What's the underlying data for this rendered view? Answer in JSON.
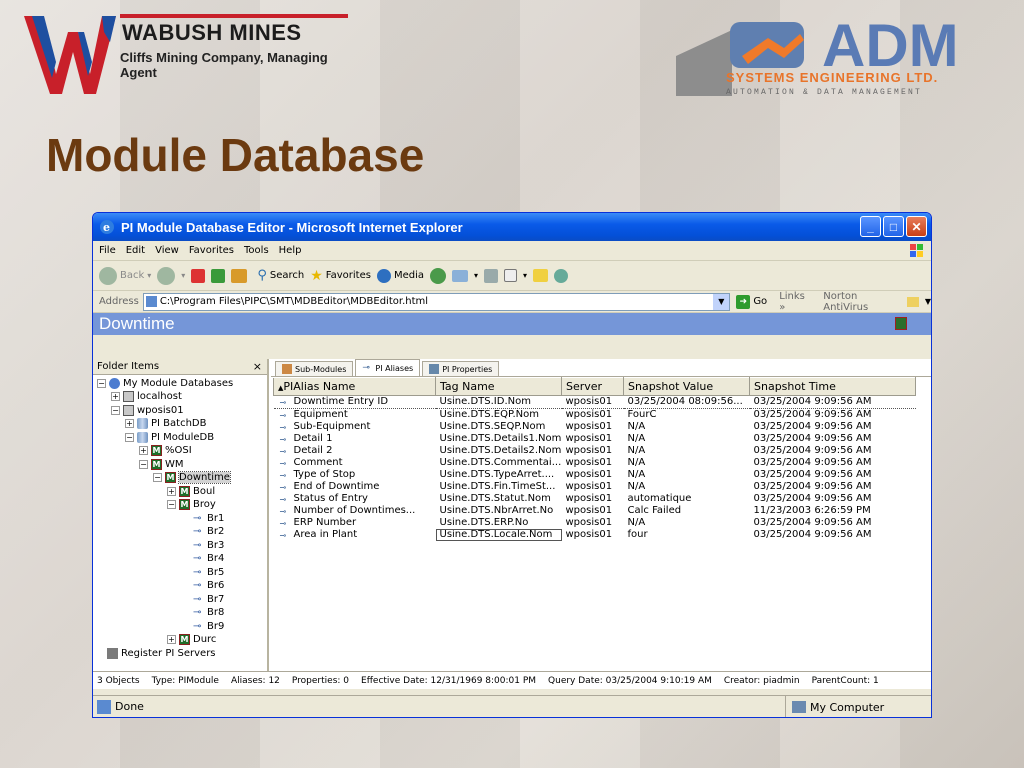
{
  "slide": {
    "title": "Module Database",
    "logo_left": {
      "name": "WABUSH MINES",
      "subtitle": "Cliffs Mining Company, Managing Agent"
    },
    "logo_right": {
      "name": "ADM",
      "line1": "SYSTEMS ENGINEERING LTD.",
      "line2": "AUTOMATION & DATA MANAGEMENT"
    }
  },
  "window": {
    "title": "PI Module Database Editor - Microsoft Internet Explorer",
    "menu": [
      "File",
      "Edit",
      "View",
      "Favorites",
      "Tools",
      "Help"
    ],
    "toolbar": {
      "back": "Back",
      "search": "Search",
      "favorites": "Favorites",
      "media": "Media"
    },
    "address": {
      "label": "Address",
      "value": "C:\\Program Files\\PIPC\\SMT\\MDBEditor\\MDBEditor.html",
      "go": "Go",
      "links": "Links",
      "links_more": "»",
      "norton": "Norton AntiVirus"
    },
    "page_header": "Downtime",
    "folder_pane": {
      "title": "Folder Items",
      "close": "×",
      "nodes": [
        {
          "label": "My Module Databases",
          "exp": "−"
        },
        {
          "label": "localhost",
          "exp": "+"
        },
        {
          "label": "wposis01",
          "exp": "−"
        },
        {
          "label": "PI BatchDB",
          "exp": "+"
        },
        {
          "label": "PI ModuleDB",
          "exp": "−"
        },
        {
          "label": "%OSI",
          "exp": "+"
        },
        {
          "label": "WM",
          "exp": "−"
        },
        {
          "label": "Downtime",
          "exp": "−"
        },
        {
          "label": "Boul",
          "exp": "+"
        },
        {
          "label": "Broy",
          "exp": "−"
        },
        {
          "label": "Br1"
        },
        {
          "label": "Br2"
        },
        {
          "label": "Br3"
        },
        {
          "label": "Br4"
        },
        {
          "label": "Br5"
        },
        {
          "label": "Br6"
        },
        {
          "label": "Br7"
        },
        {
          "label": "Br8"
        },
        {
          "label": "Br9"
        },
        {
          "label": "Durc",
          "exp": "+"
        },
        {
          "label": "Register PI Servers"
        }
      ]
    },
    "tabs": [
      "Sub-Modules",
      "PI Aliases",
      "PI Properties"
    ],
    "table": {
      "sort_indicator": "▲",
      "columns": [
        "PIAlias Name",
        "Tag Name",
        "Server",
        "Snapshot Value",
        "Snapshot Time"
      ],
      "rows": [
        [
          "Downtime Entry ID",
          "Usine.DTS.ID.Nom",
          "wposis01",
          "03/25/2004 08:09:56...",
          "03/25/2004 9:09:56 AM"
        ],
        [
          "Equipment",
          "Usine.DTS.EQP.Nom",
          "wposis01",
          "FourC",
          "03/25/2004 9:09:56 AM"
        ],
        [
          "Sub-Equipment",
          "Usine.DTS.SEQP.Nom",
          "wposis01",
          "N/A",
          "03/25/2004 9:09:56 AM"
        ],
        [
          "Detail 1",
          "Usine.DTS.Details1.Nom",
          "wposis01",
          "N/A",
          "03/25/2004 9:09:56 AM"
        ],
        [
          "Detail 2",
          "Usine.DTS.Details2.Nom",
          "wposis01",
          "N/A",
          "03/25/2004 9:09:56 AM"
        ],
        [
          "Comment",
          "Usine.DTS.Commentai...",
          "wposis01",
          "N/A",
          "03/25/2004 9:09:56 AM"
        ],
        [
          "Type of Stop",
          "Usine.DTS.TypeArret....",
          "wposis01",
          "N/A",
          "03/25/2004 9:09:56 AM"
        ],
        [
          "End of Downtime",
          "Usine.DTS.Fin.TimeSt...",
          "wposis01",
          "N/A",
          "03/25/2004 9:09:56 AM"
        ],
        [
          "Status of Entry",
          "Usine.DTS.Statut.Nom",
          "wposis01",
          "automatique",
          "03/25/2004 9:09:56 AM"
        ],
        [
          "Number of Downtimes...",
          "Usine.DTS.NbrArret.No",
          "wposis01",
          "Calc Failed",
          "11/23/2003 6:26:59 PM"
        ],
        [
          "ERP Number",
          "Usine.DTS.ERP.No",
          "wposis01",
          "N/A",
          "03/25/2004 9:09:56 AM"
        ],
        [
          "Area in Plant",
          "Usine.DTS.Locale.Nom",
          "wposis01",
          "four",
          "03/25/2004 9:09:56 AM"
        ]
      ]
    },
    "statusline": [
      "3 Objects",
      "Type: PIModule",
      "Aliases: 12",
      "Properties: 0",
      "Effective Date: 12/31/1969 8:00:01 PM",
      "Query Date: 03/25/2004 9:10:19 AM",
      "Creator: piadmin",
      "ParentCount: 1"
    ],
    "ie_status": {
      "left": "Done",
      "right": "My Computer"
    }
  }
}
